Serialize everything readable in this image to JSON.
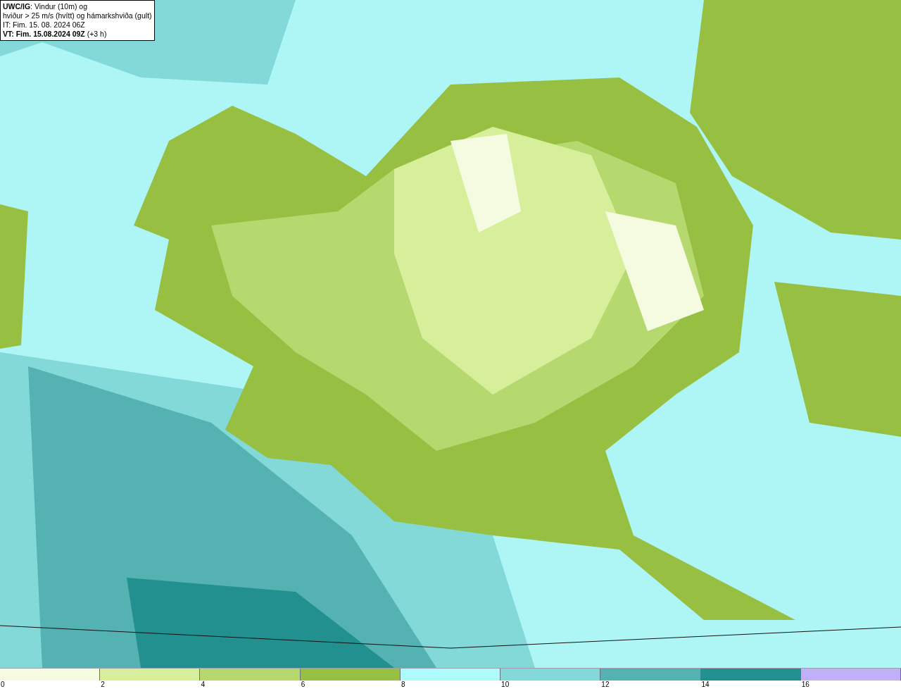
{
  "info_box": {
    "lines": [
      "**UWC/IG**: Vindur (10m) og",
      "hviður > 25 m/s (hvítt) og hámarkshviða (gult)",
      "IT: Fim. 15. 08. 2024 06Z",
      "**VT: Fim. 15.08.2024 09Z** (+3 h)"
    ]
  },
  "legend": [
    {
      "label": "0",
      "color": "#f5fbe0"
    },
    {
      "label": "2",
      "color": "#d7ef9b"
    },
    {
      "label": "4",
      "color": "#b5d86f"
    },
    {
      "label": "6",
      "color": "#97c043"
    },
    {
      "label": "8",
      "color": "#aefbfb"
    },
    {
      "label": "10",
      "color": "#83d8d8"
    },
    {
      "label": "12",
      "color": "#55b2b2"
    },
    {
      "label": "14",
      "color": "#239090"
    },
    {
      "label": "16",
      "color": "#c0b0f8"
    }
  ]
}
